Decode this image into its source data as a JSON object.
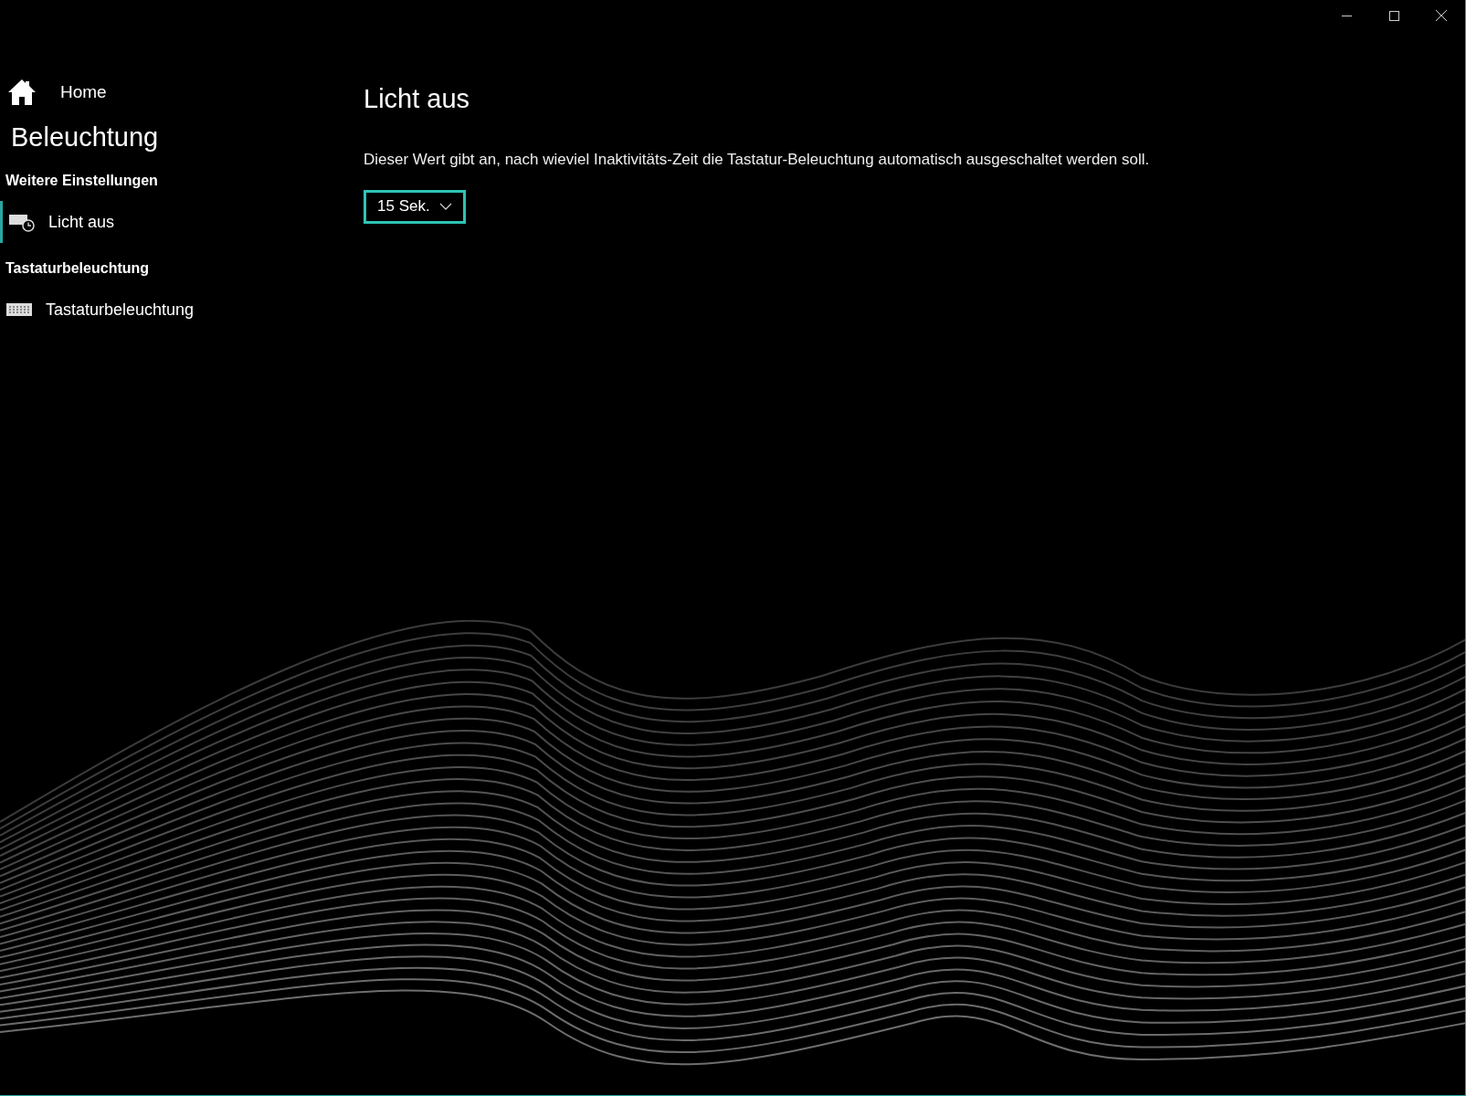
{
  "sidebar": {
    "home": "Home",
    "title": "Beleuchtung",
    "sections": [
      {
        "heading": "Weitere Einstellungen",
        "items": [
          {
            "label": "Licht aus",
            "kind": "keyboard-timer",
            "selected": true
          }
        ]
      },
      {
        "heading": "Tastaturbeleuchtung",
        "items": [
          {
            "label": "Tastaturbeleuchtung",
            "kind": "keyboard",
            "selected": false
          }
        ]
      }
    ]
  },
  "content": {
    "title": "Licht aus",
    "description": "Dieser Wert gibt an, nach wieviel Inaktivitäts-Zeit die Tastatur-Beleuchtung automatisch ausgeschaltet werden soll.",
    "dropdown": {
      "value": "15 Sek."
    }
  }
}
